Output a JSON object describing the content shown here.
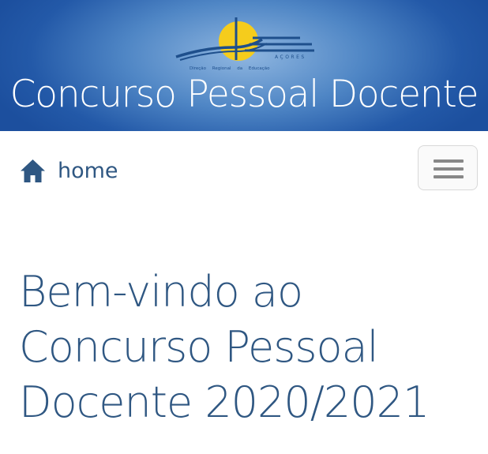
{
  "header": {
    "logo_icon": "dre-azores-logo-icon",
    "logo_caption": "Direção Regional da Educação",
    "logo_acronym": "AÇORES",
    "title": "Concurso Pessoal Docente",
    "colors": {
      "banner_dark": "#1c4f9e",
      "banner_light": "#8fb6e0",
      "logo_sun": "#f5cc1c",
      "logo_lines": "#1e4f8c"
    }
  },
  "nav": {
    "home_icon": "home-icon",
    "home_label": "home",
    "menu_icon": "hamburger-menu-icon"
  },
  "main": {
    "welcome_lines": [
      "Bem-vindo ao",
      "Concurso Pessoal",
      "Docente 2020/2021"
    ],
    "text_color": "#2f5782"
  }
}
